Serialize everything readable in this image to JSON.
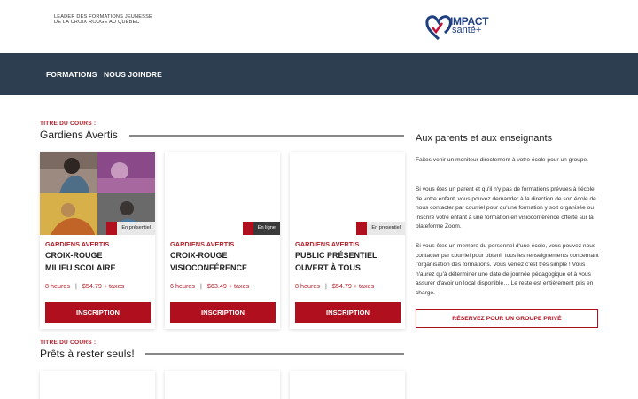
{
  "header": {
    "tagline_line1": "LEADER DES FORMATIONS JEUNESSE",
    "tagline_line2": "DE LA CROIX ROUGE AU QUÉBEC",
    "logo_line1": "IMPACT",
    "logo_line2": "santé+"
  },
  "nav": {
    "items": [
      {
        "label": "FORMATIONS"
      },
      {
        "label": "NOUS JOINDRE"
      }
    ]
  },
  "sections": [
    {
      "kicker": "TITRE DU COURS :",
      "title": "Gardiens Avertis",
      "cards": [
        {
          "badge": "En présentiel",
          "kicker": "GARDIENS AVERTIS",
          "title_line1": "CROIX-ROUGE",
          "title_line2": "MILIEU SCOLAIRE",
          "hours": "8 heures",
          "price": "$54.79 + taxes",
          "button": "INSCRIPTION"
        },
        {
          "badge": "En ligne",
          "kicker": "GARDIENS AVERTIS",
          "title_line1": "CROIX-ROUGE",
          "title_line2": "VISIOCONFÉRENCE",
          "hours": "6 heures",
          "price": "$63.49 + taxes",
          "button": "INSCRIPTION"
        },
        {
          "badge": "En présentiel",
          "kicker": "GARDIENS AVERTIS",
          "title_line1": "PUBLIC PRÉSENTIEL",
          "title_line2": "OUVERT À TOUS",
          "hours": "8 heures",
          "price": "$54.79 + taxes",
          "button": "INSCRIPTION"
        }
      ]
    },
    {
      "kicker": "TITRE DU COURS :",
      "title": "Prêts à rester seuls!"
    }
  ],
  "sidebar": {
    "title": "Aux parents et aux enseignants",
    "paragraph1": "Faites venir un moniteur directement à votre école pour un groupe.",
    "paragraph2": "Si vous êtes un parent et qu'il n'y pas de formations prévues à l'école de votre enfant, vous pouvez demander à la direction de son école de nous contacter par courriel pour qu'une formation y soit organisée ou inscrire votre enfant à une formation en visioconférence offerte sur la plateforme Zoom.",
    "paragraph3": "Si vous êtes un membre du personnel d'une école, vous pouvez nous contacter par courriel pour obtenir tous les renseignements concernant l'organisation des formations. Vous verrez c'est très simple ! Vous n'aurez qu'à déterminer une date de journée pédagogique et à vous assurer d'avoir un local disponible… Le reste est entièrement pris en charge.",
    "button": "RÉSERVEZ POUR UN GROUPE PRIVÉ"
  },
  "colors": {
    "accent_red": "#b0101e",
    "navbar": "#2c3e50",
    "brand_blue": "#1f3f80"
  }
}
